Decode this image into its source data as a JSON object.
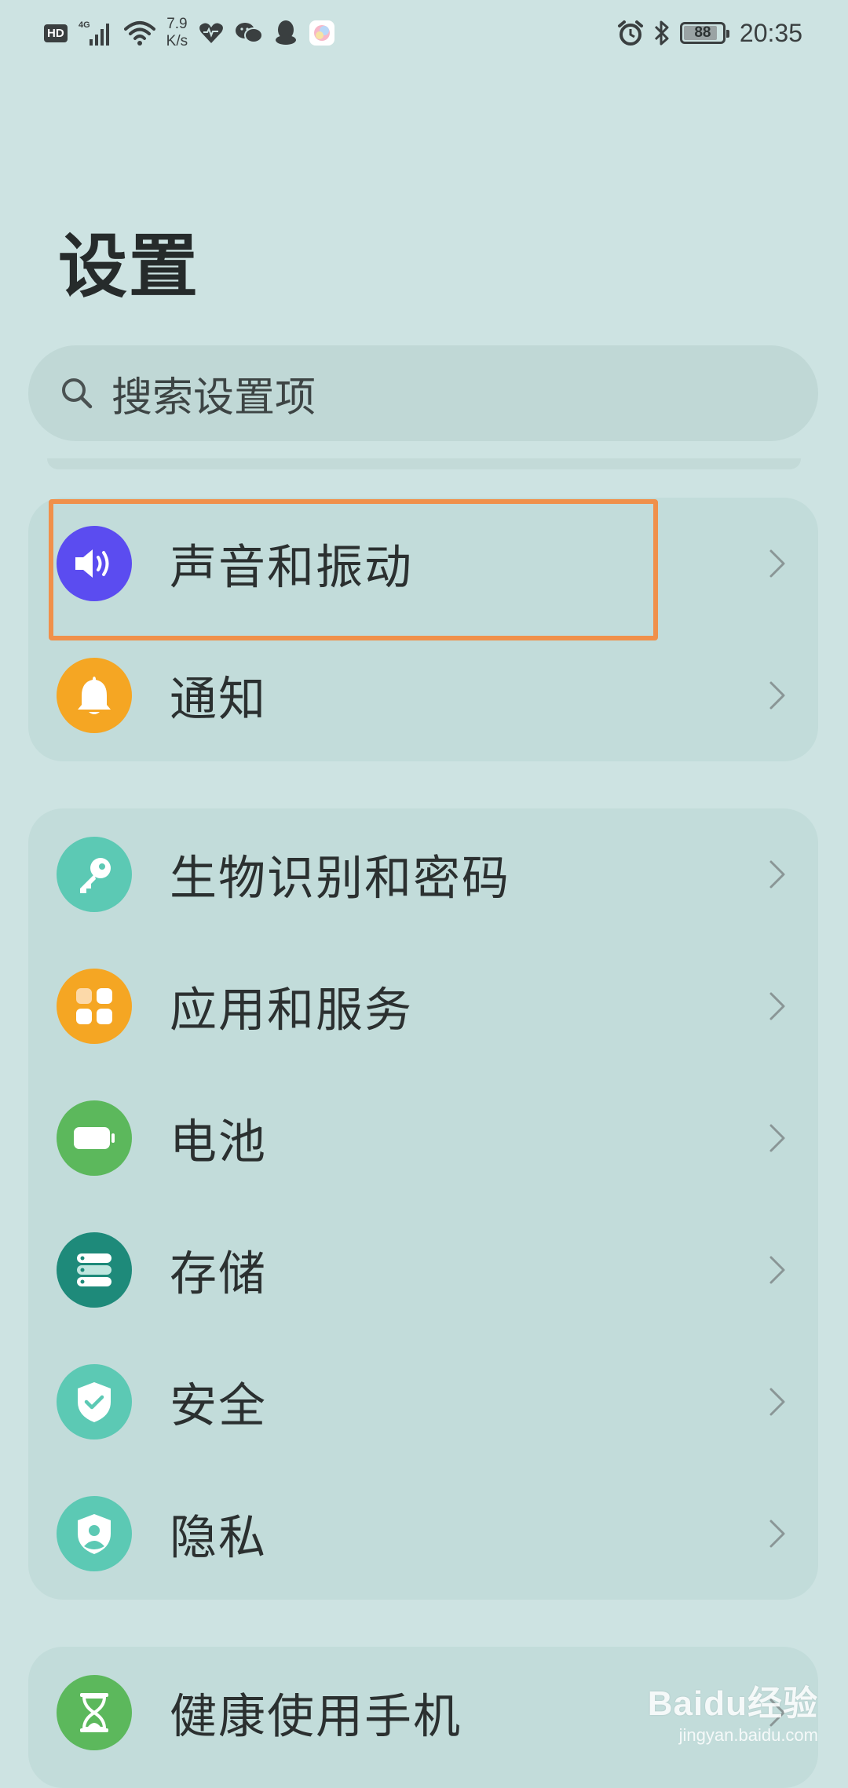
{
  "status_bar": {
    "hd_badge": "HD",
    "network_type": "4G",
    "net_speed_value": "7.9",
    "net_speed_unit": "K/s",
    "battery_level": 88,
    "battery_text": "88",
    "time": "20:35",
    "icons_left": [
      "hd-icon",
      "signal-icon",
      "wifi-icon",
      "health-icon",
      "wechat-icon",
      "qq-icon",
      "app-icon"
    ],
    "icons_right": [
      "alarm-icon",
      "bluetooth-icon",
      "battery-icon"
    ]
  },
  "page": {
    "title": "设置"
  },
  "search": {
    "placeholder": "搜索设置项",
    "icon": "search-icon"
  },
  "groups": [
    {
      "items": [
        {
          "label": "声音和振动",
          "icon": "speaker-icon",
          "color": "#5b4cf0"
        },
        {
          "label": "通知",
          "icon": "bell-icon",
          "color": "#f5a623"
        }
      ]
    },
    {
      "items": [
        {
          "label": "生物识别和密码",
          "icon": "key-icon",
          "color": "#5cc9b4"
        },
        {
          "label": "应用和服务",
          "icon": "apps-icon",
          "color": "#f5a623"
        },
        {
          "label": "电池",
          "icon": "battery-icon",
          "color": "#5cb85c"
        },
        {
          "label": "存储",
          "icon": "storage-icon",
          "color": "#1e8a7a"
        },
        {
          "label": "安全",
          "icon": "shield-check-icon",
          "color": "#5cc9b4"
        },
        {
          "label": "隐私",
          "icon": "privacy-shield-icon",
          "color": "#5cc9b4"
        }
      ]
    },
    {
      "items": [
        {
          "label": "健康使用手机",
          "icon": "hourglass-icon",
          "color": "#5cb85c"
        }
      ]
    }
  ],
  "watermark": {
    "main": "Baidu经验",
    "sub": "jingyan.baidu.com"
  }
}
